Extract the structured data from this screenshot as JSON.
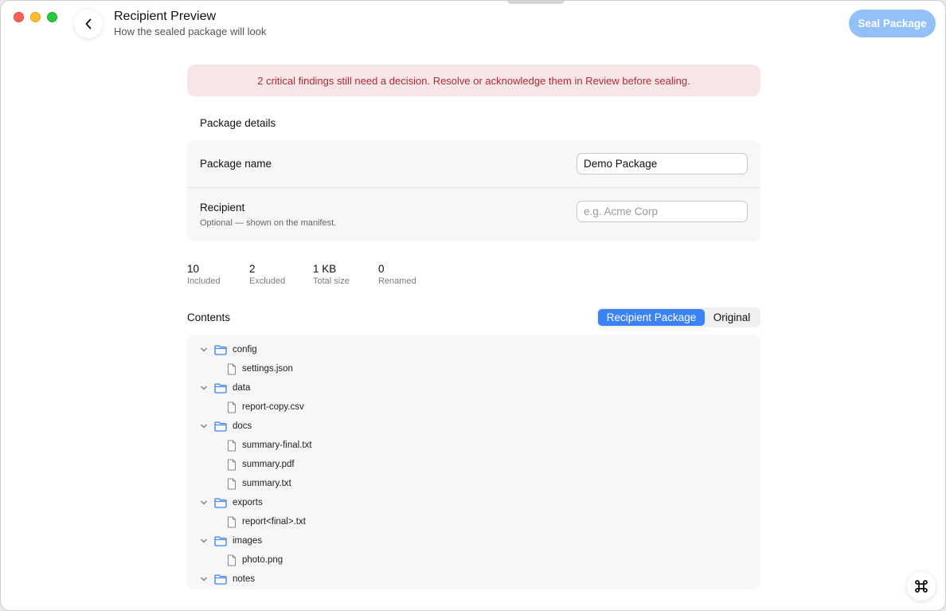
{
  "header": {
    "title": "Recipient Preview",
    "subtitle": "How the sealed package will look",
    "seal_label": "Seal Package"
  },
  "alert": {
    "text": "2 critical findings still need a decision. Resolve or acknowledge them in Review before sealing."
  },
  "details": {
    "section_title": "Package details",
    "name_label": "Package name",
    "name_value": "Demo Package",
    "recipient_label": "Recipient",
    "recipient_hint": "Optional — shown on the manifest.",
    "recipient_placeholder": "e.g. Acme Corp"
  },
  "stats": [
    {
      "value": "10",
      "label": "Included"
    },
    {
      "value": "2",
      "label": "Excluded"
    },
    {
      "value": "1 KB",
      "label": "Total size"
    },
    {
      "value": "0",
      "label": "Renamed"
    }
  ],
  "contents": {
    "title": "Contents",
    "tabs": [
      {
        "label": "Recipient Package",
        "active": true
      },
      {
        "label": "Original",
        "active": false
      }
    ],
    "tree": [
      {
        "type": "folder",
        "name": "config"
      },
      {
        "type": "file",
        "name": "settings.json"
      },
      {
        "type": "folder",
        "name": "data"
      },
      {
        "type": "file",
        "name": "report-copy.csv"
      },
      {
        "type": "folder",
        "name": "docs"
      },
      {
        "type": "file",
        "name": "summary-final.txt"
      },
      {
        "type": "file",
        "name": "summary.pdf"
      },
      {
        "type": "file",
        "name": "summary.txt"
      },
      {
        "type": "folder",
        "name": "exports"
      },
      {
        "type": "file",
        "name": "report<final>.txt"
      },
      {
        "type": "folder",
        "name": "images"
      },
      {
        "type": "file",
        "name": "photo.png"
      },
      {
        "type": "folder",
        "name": "notes"
      }
    ]
  },
  "icons": {
    "back": "chevron-left-icon",
    "folder": "folder-icon",
    "file": "file-icon",
    "expand": "chevron-down-icon",
    "fab": "command-icon"
  },
  "colors": {
    "accent": "#3b82f6",
    "seal_button": "#93c0f9",
    "alert_bg": "#f6e6e7",
    "alert_text": "#b02a37",
    "folder_icon": "#3b82f6"
  }
}
